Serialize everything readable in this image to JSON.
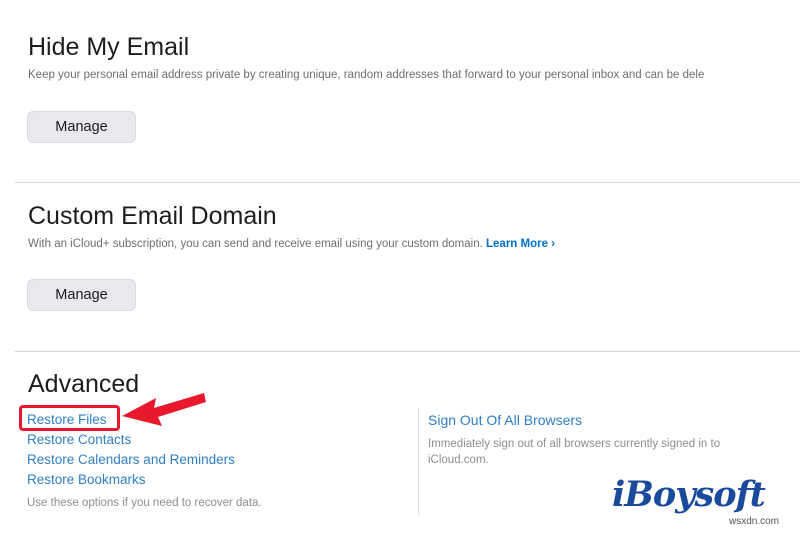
{
  "hide_my_email": {
    "title": "Hide My Email",
    "description": "Keep your personal email address private by creating unique, random addresses that forward to your personal inbox and can be dele",
    "button": "Manage"
  },
  "custom_domain": {
    "title": "Custom Email Domain",
    "description": "With an iCloud+ subscription, you can send and receive email using your custom domain.",
    "learn_more": "Learn More",
    "button": "Manage"
  },
  "advanced": {
    "title": "Advanced",
    "links": [
      "Restore Files",
      "Restore Contacts",
      "Restore Calendars and Reminders",
      "Restore Bookmarks"
    ],
    "note": "Use these options if you need to recover data.",
    "sign_out": {
      "label": "Sign Out Of All Browsers",
      "description_line1": "Immediately sign out of all browsers currently signed in to",
      "description_line2": "iCloud.com."
    }
  },
  "annotation": {
    "highlight_color": "#e8192c"
  },
  "branding": {
    "logo": "iBoysoft",
    "watermark": "wsxdn.com"
  }
}
